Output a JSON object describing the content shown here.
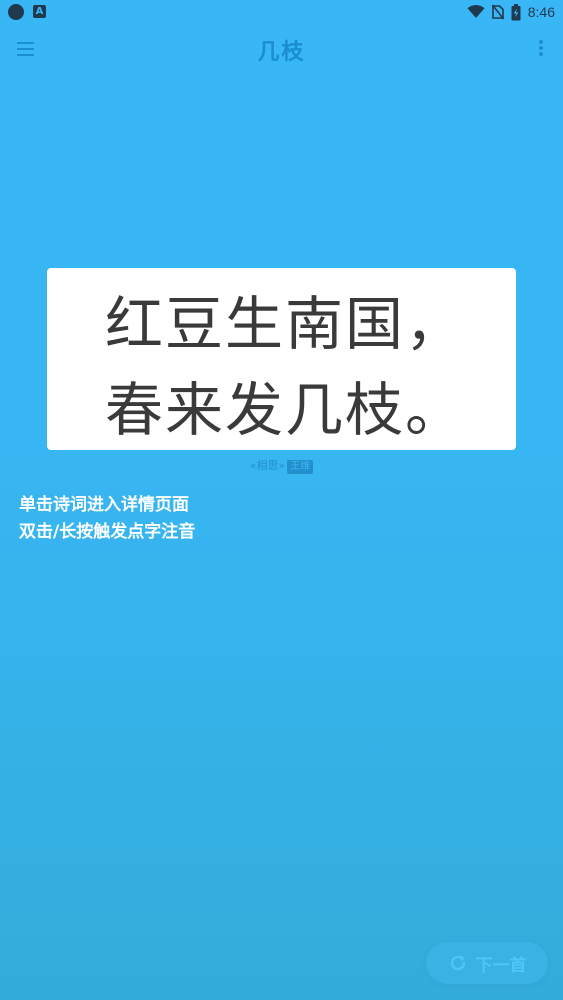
{
  "status_bar": {
    "notification_badge": "A",
    "time": "8:46"
  },
  "app_bar": {
    "title": "几枝",
    "menu_icon": "hamburger-menu-icon",
    "more_icon": "more-vertical-icon"
  },
  "poem": {
    "line1": "红豆生南国，",
    "line2": "春来发几枝。",
    "title": "«相思»",
    "author": "王维"
  },
  "hints": {
    "line1": "单击诗词进入详情页面",
    "line2": "双击/长按触发点字注音"
  },
  "next_button": {
    "label": "下一首",
    "icon": "refresh-icon"
  },
  "colors": {
    "background": "#39b6f5",
    "title": "#1a8fd0",
    "card": "#ffffff",
    "poem_text": "#3a3a3a",
    "hint_text": "#ffffff"
  }
}
